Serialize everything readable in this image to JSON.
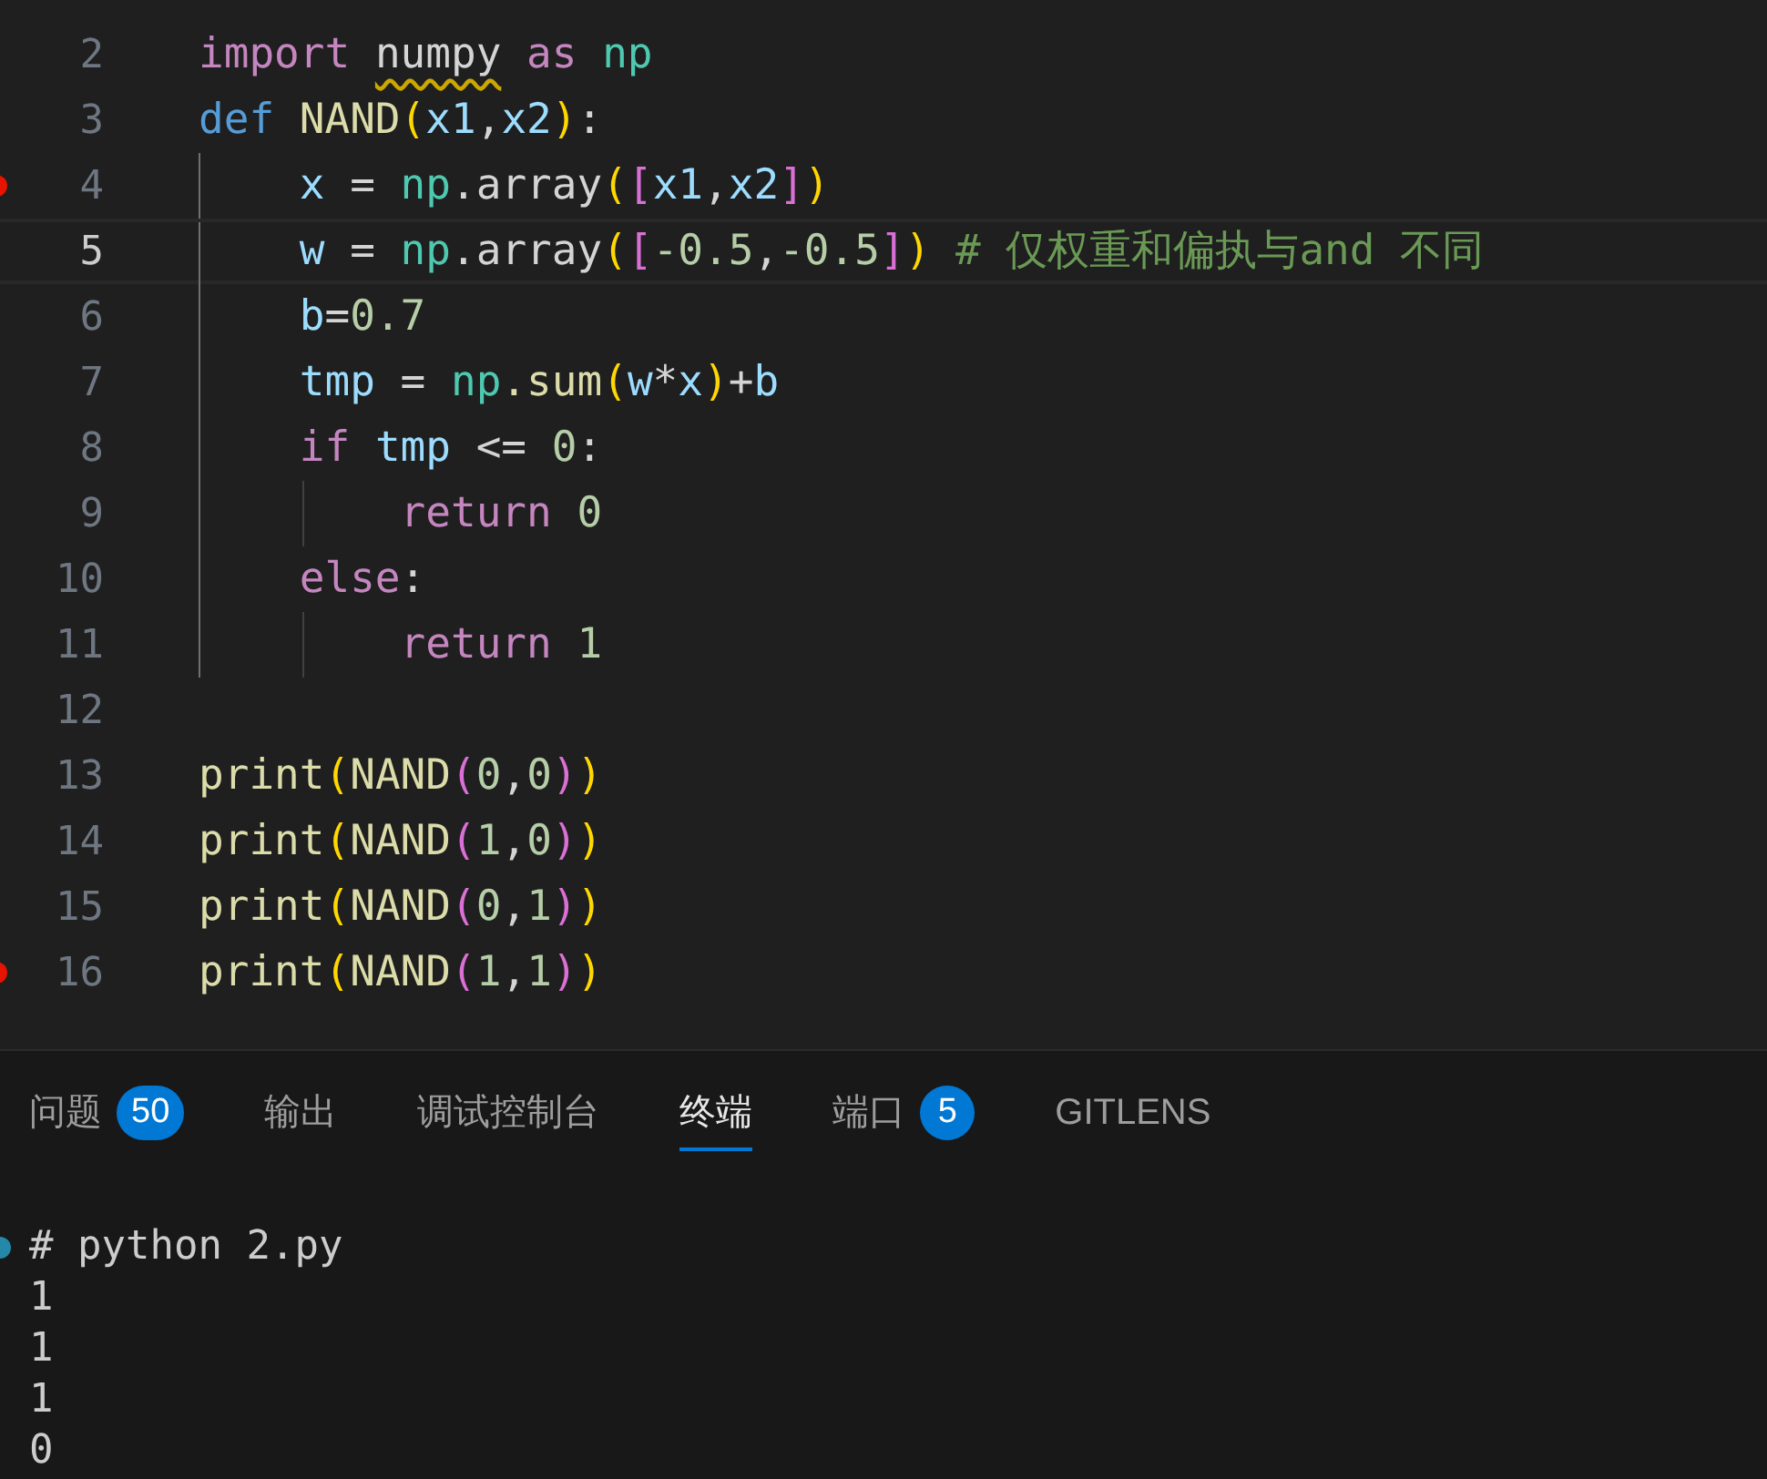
{
  "editor": {
    "lines": [
      {
        "number": "2",
        "active": false,
        "breakpoint": false,
        "tokens": [
          {
            "kind": "keyword",
            "text": "import "
          },
          {
            "kind": "warned",
            "text": "numpy"
          },
          {
            "kind": "keyword",
            "text": " as "
          },
          {
            "kind": "module",
            "text": "np"
          }
        ]
      },
      {
        "number": "3",
        "active": false,
        "breakpoint": false,
        "tokens": [
          {
            "kind": "storage",
            "text": "def "
          },
          {
            "kind": "function",
            "text": "NAND"
          },
          {
            "kind": "paren",
            "text": "("
          },
          {
            "kind": "variable",
            "text": "x1"
          },
          {
            "kind": "plain",
            "text": ","
          },
          {
            "kind": "variable",
            "text": "x2"
          },
          {
            "kind": "paren",
            "text": ")"
          },
          {
            "kind": "plain",
            "text": ":"
          }
        ]
      },
      {
        "number": "4",
        "active": false,
        "breakpoint": true,
        "tokens": [
          {
            "kind": "variable",
            "text": "    x"
          },
          {
            "kind": "plain",
            "text": " = "
          },
          {
            "kind": "module",
            "text": "np"
          },
          {
            "kind": "plain",
            "text": ".array"
          },
          {
            "kind": "paren",
            "text": "("
          },
          {
            "kind": "bracket",
            "text": "["
          },
          {
            "kind": "variable",
            "text": "x1"
          },
          {
            "kind": "plain",
            "text": ","
          },
          {
            "kind": "variable",
            "text": "x2"
          },
          {
            "kind": "bracket",
            "text": "]"
          },
          {
            "kind": "paren",
            "text": ")"
          }
        ]
      },
      {
        "number": "5",
        "active": true,
        "breakpoint": false,
        "tokens": [
          {
            "kind": "variable",
            "text": "    w"
          },
          {
            "kind": "plain",
            "text": " = "
          },
          {
            "kind": "module",
            "text": "np"
          },
          {
            "kind": "plain",
            "text": ".array"
          },
          {
            "kind": "paren",
            "text": "("
          },
          {
            "kind": "bracket",
            "text": "["
          },
          {
            "kind": "number",
            "text": "-0.5"
          },
          {
            "kind": "plain",
            "text": ","
          },
          {
            "kind": "number",
            "text": "-0.5"
          },
          {
            "kind": "bracket",
            "text": "]"
          },
          {
            "kind": "paren",
            "text": ")"
          },
          {
            "kind": "comment",
            "text": " # 仅权重和偏执与and 不同"
          }
        ]
      },
      {
        "number": "6",
        "active": false,
        "breakpoint": false,
        "tokens": [
          {
            "kind": "variable",
            "text": "    b"
          },
          {
            "kind": "plain",
            "text": "="
          },
          {
            "kind": "number",
            "text": "0.7"
          }
        ]
      },
      {
        "number": "7",
        "active": false,
        "breakpoint": false,
        "tokens": [
          {
            "kind": "variable",
            "text": "    tmp"
          },
          {
            "kind": "plain",
            "text": " = "
          },
          {
            "kind": "module",
            "text": "np"
          },
          {
            "kind": "function",
            "text": ".sum"
          },
          {
            "kind": "paren",
            "text": "("
          },
          {
            "kind": "variable",
            "text": "w"
          },
          {
            "kind": "plain",
            "text": "*"
          },
          {
            "kind": "variable",
            "text": "x"
          },
          {
            "kind": "paren",
            "text": ")"
          },
          {
            "kind": "plain",
            "text": "+"
          },
          {
            "kind": "variable",
            "text": "b"
          }
        ]
      },
      {
        "number": "8",
        "active": false,
        "breakpoint": false,
        "tokens": [
          {
            "kind": "keyword",
            "text": "    if "
          },
          {
            "kind": "variable",
            "text": "tmp"
          },
          {
            "kind": "plain",
            "text": " <= "
          },
          {
            "kind": "number",
            "text": "0"
          },
          {
            "kind": "plain",
            "text": ":"
          }
        ]
      },
      {
        "number": "9",
        "active": false,
        "breakpoint": false,
        "tokens": [
          {
            "kind": "keyword",
            "text": "        return "
          },
          {
            "kind": "number",
            "text": "0"
          }
        ]
      },
      {
        "number": "10",
        "active": false,
        "breakpoint": false,
        "tokens": [
          {
            "kind": "keyword",
            "text": "    else"
          },
          {
            "kind": "plain",
            "text": ":"
          }
        ]
      },
      {
        "number": "11",
        "active": false,
        "breakpoint": false,
        "tokens": [
          {
            "kind": "keyword",
            "text": "        return "
          },
          {
            "kind": "number",
            "text": "1"
          }
        ]
      },
      {
        "number": "12",
        "active": false,
        "breakpoint": false
      },
      {
        "number": "13",
        "active": false,
        "breakpoint": false,
        "tokens": [
          {
            "kind": "function",
            "text": "print"
          },
          {
            "kind": "paren",
            "text": "("
          },
          {
            "kind": "function",
            "text": "NAND"
          },
          {
            "kind": "bracket",
            "text": "("
          },
          {
            "kind": "number",
            "text": "0"
          },
          {
            "kind": "plain",
            "text": ","
          },
          {
            "kind": "number",
            "text": "0"
          },
          {
            "kind": "bracket",
            "text": ")"
          },
          {
            "kind": "paren",
            "text": ")"
          }
        ]
      },
      {
        "number": "14",
        "active": false,
        "breakpoint": false,
        "tokens": [
          {
            "kind": "function",
            "text": "print"
          },
          {
            "kind": "paren",
            "text": "("
          },
          {
            "kind": "function",
            "text": "NAND"
          },
          {
            "kind": "bracket",
            "text": "("
          },
          {
            "kind": "number",
            "text": "1"
          },
          {
            "kind": "plain",
            "text": ","
          },
          {
            "kind": "number",
            "text": "0"
          },
          {
            "kind": "bracket",
            "text": ")"
          },
          {
            "kind": "paren",
            "text": ")"
          }
        ]
      },
      {
        "number": "15",
        "active": false,
        "breakpoint": false,
        "tokens": [
          {
            "kind": "function",
            "text": "print"
          },
          {
            "kind": "paren",
            "text": "("
          },
          {
            "kind": "function",
            "text": "NAND"
          },
          {
            "kind": "bracket",
            "text": "("
          },
          {
            "kind": "number",
            "text": "0"
          },
          {
            "kind": "plain",
            "text": ","
          },
          {
            "kind": "number",
            "text": "1"
          },
          {
            "kind": "bracket",
            "text": ")"
          },
          {
            "kind": "paren",
            "text": ")"
          }
        ]
      },
      {
        "number": "16",
        "active": false,
        "breakpoint": true,
        "tokens": [
          {
            "kind": "function",
            "text": "print"
          },
          {
            "kind": "paren",
            "text": "("
          },
          {
            "kind": "function",
            "text": "NAND"
          },
          {
            "kind": "bracket",
            "text": "("
          },
          {
            "kind": "number",
            "text": "1"
          },
          {
            "kind": "plain",
            "text": ","
          },
          {
            "kind": "number",
            "text": "1"
          },
          {
            "kind": "bracket",
            "text": ")"
          },
          {
            "kind": "paren",
            "text": ")"
          }
        ]
      }
    ]
  },
  "panel": {
    "tabs": [
      {
        "label": "问题",
        "badge": "50",
        "selected": false
      },
      {
        "label": "输出",
        "selected": false
      },
      {
        "label": "调试控制台",
        "selected": false
      },
      {
        "label": "终端",
        "selected": true
      },
      {
        "label": "端口",
        "badge": "5",
        "selected": false
      },
      {
        "label": "GITLENS",
        "selected": false
      }
    ],
    "terminal": {
      "command": "# python 2.py",
      "output": [
        "1",
        "1",
        "1",
        "0"
      ]
    }
  }
}
